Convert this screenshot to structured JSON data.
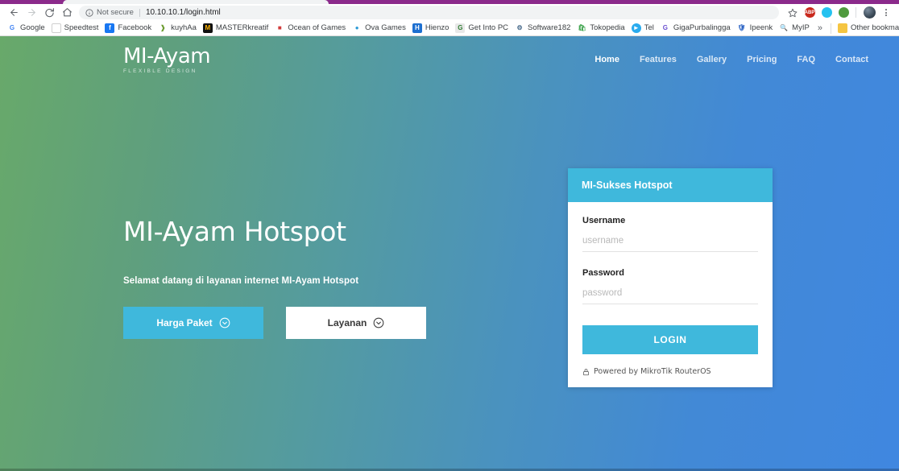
{
  "browser": {
    "nav": {
      "back": "back-arrow",
      "forward": "forward-arrow",
      "reload": "reload-icon",
      "home": "home-icon"
    },
    "omnibox": {
      "security_label": "Not secure",
      "url": "10.10.10.1/login.html",
      "info_icon": "info-circle-icon"
    },
    "toolbar_icons": [
      {
        "name": "bookmark-star-icon",
        "glyph": "star"
      },
      {
        "name": "adblock-plus-extension-icon",
        "label": "ABP",
        "color": "#c9291d"
      },
      {
        "name": "ghostery-extension-icon",
        "label": "",
        "color": "#25c2f0"
      },
      {
        "name": "globe-extension-icon",
        "label": "",
        "color": "#4f9a3d"
      }
    ],
    "profile": {
      "name": "profile-avatar"
    },
    "menu": {
      "name": "chrome-menu-icon"
    },
    "bookmarks": [
      {
        "label": "Google",
        "icon": "google-favicon",
        "bg": "#ffffff",
        "fg": "#4285f4",
        "text": "G"
      },
      {
        "label": "Speedtest",
        "icon": "page-favicon",
        "bg": "#ffffff",
        "fg": "#9aa0a6",
        "text": ""
      },
      {
        "label": "Facebook",
        "icon": "facebook-favicon",
        "bg": "#1877f2",
        "fg": "#ffffff",
        "text": "f"
      },
      {
        "label": "kuyhAa",
        "icon": "kuyhaa-favicon",
        "bg": "#ffffff",
        "fg": "#6b9b2f",
        "text": ""
      },
      {
        "label": "MASTERkreatif",
        "icon": "masterkreatif-favicon",
        "bg": "#111111",
        "fg": "#ffb300",
        "text": "M"
      },
      {
        "label": "Ocean of Games",
        "icon": "oceanofgames-favicon",
        "bg": "#ffffff",
        "fg": "#d23b3b",
        "text": ""
      },
      {
        "label": "Ova Games",
        "icon": "ovagames-favicon",
        "bg": "#ffffff",
        "fg": "#2b9ad6",
        "text": ""
      },
      {
        "label": "Hienzo",
        "icon": "hienzo-favicon",
        "bg": "#1d6fd0",
        "fg": "#ffffff",
        "text": "H"
      },
      {
        "label": "Get Into PC",
        "icon": "getintopc-favicon",
        "bg": "#e8e8e8",
        "fg": "#2f7d32",
        "text": "G"
      },
      {
        "label": "Software182",
        "icon": "software182-favicon",
        "bg": "#ffffff",
        "fg": "#4a6c8c",
        "text": ""
      },
      {
        "label": "Tokopedia",
        "icon": "tokopedia-favicon",
        "bg": "#ffffff",
        "fg": "#3ba24a",
        "text": ""
      },
      {
        "label": "Tel",
        "icon": "telegram-favicon",
        "bg": "#2aabee",
        "fg": "#ffffff",
        "text": ""
      },
      {
        "label": "GigaPurbalingga",
        "icon": "gigapurbalingga-favicon",
        "bg": "#ffffff",
        "fg": "#6a4fd0",
        "text": "G"
      },
      {
        "label": "Ipeenk",
        "icon": "ipeenk-favicon",
        "bg": "#ffffff",
        "fg": "#2b63c4",
        "text": ""
      },
      {
        "label": "MyIP",
        "icon": "myip-favicon",
        "bg": "#ffffff",
        "fg": "#9aa0a6",
        "text": ""
      }
    ],
    "bookmarks_overflow": "»",
    "other_bookmarks": {
      "label": "Other bookmarks",
      "icon": "folder-icon"
    }
  },
  "site": {
    "brand": {
      "name": "MI-Ayam",
      "tagline": "FLEXIBLE DESIGN"
    },
    "nav": [
      {
        "label": "Home",
        "active": true
      },
      {
        "label": "Features",
        "active": false
      },
      {
        "label": "Gallery",
        "active": false
      },
      {
        "label": "Pricing",
        "active": false
      },
      {
        "label": "FAQ",
        "active": false
      },
      {
        "label": "Contact",
        "active": false
      }
    ],
    "hero": {
      "title": "MI-Ayam Hotspot",
      "subtitle": "Selamat datang di layanan internet MI-Ayam Hotspot",
      "buttons": [
        {
          "label": "Harga Paket",
          "style": "primary",
          "icon": "chevron-down-circle-icon"
        },
        {
          "label": "Layanan",
          "style": "secondary",
          "icon": "chevron-down-circle-icon"
        }
      ]
    },
    "login_card": {
      "header_title": "MI-Sukses Hotspot",
      "username": {
        "label": "Username",
        "value": "",
        "placeholder": "username"
      },
      "password": {
        "label": "Password",
        "value": "",
        "placeholder": "password"
      },
      "submit_label": "LOGIN",
      "footer": {
        "text": "Powered by MikroTik RouterOS",
        "icon": "lock-icon"
      }
    }
  },
  "colors": {
    "accent_cyan": "#3fb8dc",
    "gradient_start": "#68a96a",
    "gradient_end": "#4087e0",
    "tabstrip_purple": "#8b2a8b"
  }
}
